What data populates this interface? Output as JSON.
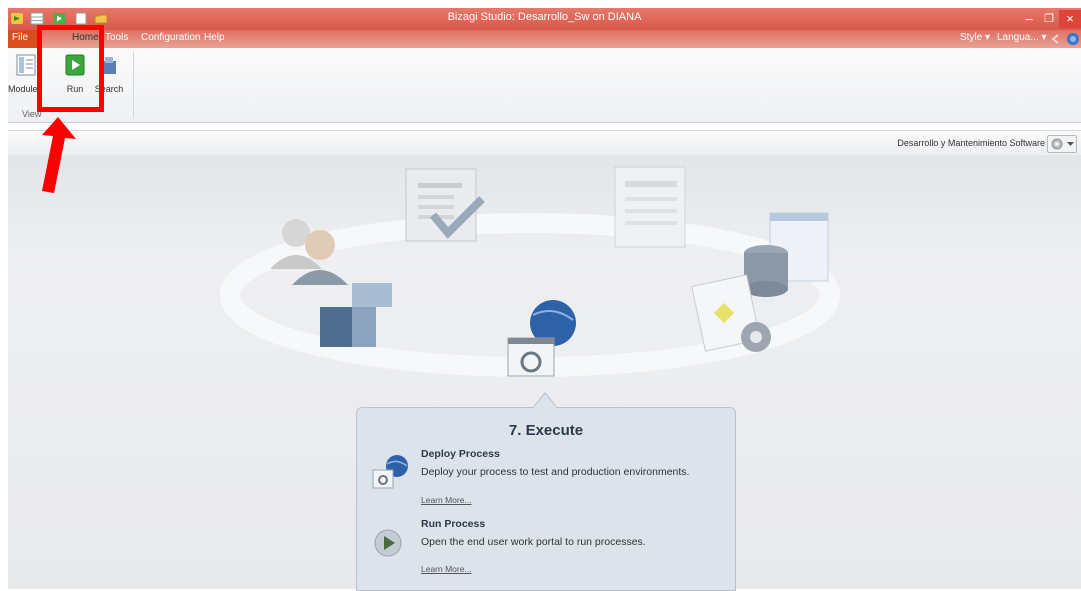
{
  "window": {
    "title": "Bizagi Studio: Desarrollo_Sw on DIANA",
    "minimize_glyph": "–",
    "restore_glyph": "❐",
    "close_glyph": "×"
  },
  "menu": {
    "file": "File",
    "home": "Home",
    "tools": "Tools",
    "configuration": "Configuration",
    "help": "Help",
    "style": "Style ▾",
    "language": "Langua... ▾"
  },
  "ribbon": {
    "buttons": [
      {
        "label": "Modules",
        "icon": "modules-icon"
      },
      {
        "label": "Run",
        "icon": "run-icon"
      },
      {
        "label": "Search",
        "icon": "search-icon"
      }
    ],
    "group_label": "View"
  },
  "toolbar": {
    "project_name": "Desarrollo y Mantenimiento Software"
  },
  "step": {
    "title": "7. Execute",
    "items": [
      {
        "title": "Deploy Process",
        "description": "Deploy your process to test and production environments.",
        "link": "Learn More..."
      },
      {
        "title": "Run Process",
        "description": "Open the end user work portal to run processes.",
        "link": "Learn More..."
      }
    ]
  },
  "colors": {
    "titlebar": "#d8584a",
    "file_tab": "#d94e1f",
    "highlight": "#ff0000",
    "run_green": "#3aa83a"
  }
}
